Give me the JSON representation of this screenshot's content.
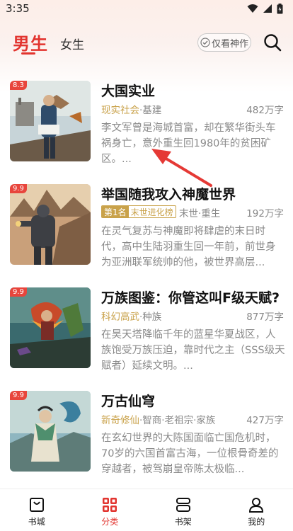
{
  "status": {
    "time": "3:35"
  },
  "header": {
    "tab_male": "男生",
    "tab_female": "女生",
    "filter_label": "仅看神作"
  },
  "books": [
    {
      "score": "8.3",
      "title": "大国实业",
      "genre": "现实社会",
      "tags": "·基建",
      "words": "482万字",
      "desc": "李文军曾是海城首富，却在繁华街头车祸身亡，意外重生回1980年的贫困矿区。..."
    },
    {
      "score": "9.9",
      "title": "举国随我攻入神魔世界",
      "rank_num": "第1名",
      "rank_name": "末世进化榜",
      "tags": "末世·重生",
      "words": "192万字",
      "desc": "在灵气复苏与神魔即将肆虐的末日时代，高中生陆羽重生回一年前，前世身为亚洲联军统帅的他，被世界高层..."
    },
    {
      "score": "9.9",
      "title": "万族图鉴：你管这叫F级天赋?",
      "genre": "科幻高武",
      "tags": "·种族",
      "words": "877万字",
      "desc": "在昊天塔降临千年的蓝星华夏战区，人族饱受万族压迫，靠时代之主（SSS级天赋者）延续文明。..."
    },
    {
      "score": "9.9",
      "title": "万古仙穹",
      "genre": "新奇修仙",
      "tags": "·智商·老祖宗·家族",
      "words": "427万字",
      "desc": "在玄幻世界的大陈国面临亡国危机时，70岁的六国首富古海，一位根骨奇差的穿越者，被驾崩皇帝陈太极临..."
    }
  ],
  "nav": [
    {
      "label": "书城",
      "icon": "bag-icon"
    },
    {
      "label": "分类",
      "icon": "grid-icon"
    },
    {
      "label": "书架",
      "icon": "shelf-icon"
    },
    {
      "label": "我的",
      "icon": "person-icon"
    }
  ],
  "colors": {
    "accent": "#e2342f",
    "gold": "#c9a24a",
    "score_bg": "#e8453c"
  }
}
